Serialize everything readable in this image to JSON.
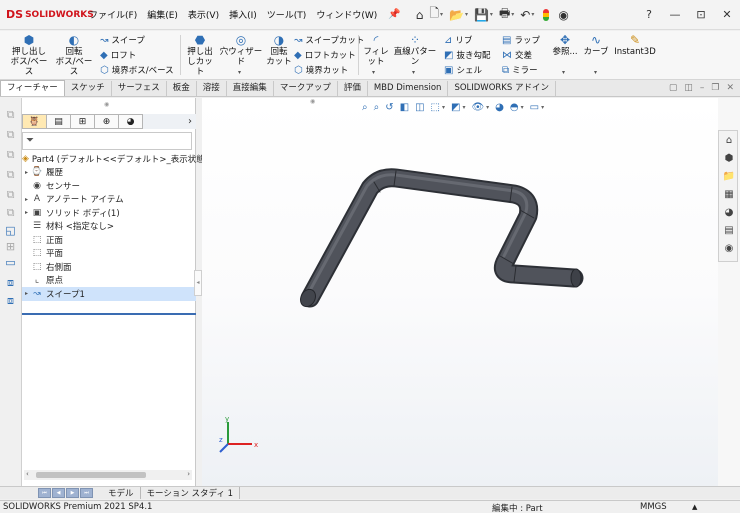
{
  "app": {
    "logo_mark": "DS",
    "logo_text": "SOLIDWORKS"
  },
  "menu": [
    "ファイル(F)",
    "編集(E)",
    "表示(V)",
    "挿入(I)",
    "ツール(T)",
    "ウィンドウ(W)"
  ],
  "quick_access": [
    "home-icon",
    "new-document-icon",
    "open-icon",
    "save-icon",
    "print-icon",
    "undo-icon",
    "rebuild-icon",
    "options-icon"
  ],
  "window_controls": {
    "help": "?",
    "minimize": "—",
    "restore": "⊡",
    "close": "✕"
  },
  "ribbon": {
    "extrude_boss": [
      "押し出し",
      "ボス/ベース"
    ],
    "revolve_boss": [
      "回転",
      "ボス/ベース"
    ],
    "sweep": "スイープ",
    "loft": "ロフト",
    "boundary_boss": "境界ボス/ベース",
    "extrude_cut": [
      "押し出",
      "しカット"
    ],
    "hole_wizard": "穴ウィザード",
    "revolve_cut": [
      "回転",
      "カット"
    ],
    "swept_cut": "スイープカット",
    "lofted_cut": "ロフトカット",
    "boundary_cut": "境界カット",
    "fillet": "フィレット",
    "linear_pattern": "直線パターン",
    "rib": "リブ",
    "draft": "抜き勾配",
    "shell": "シェル",
    "wrap": "ラップ",
    "intersect": "交差",
    "mirror": "ミラー",
    "reference": "参照...",
    "curves": "カーブ",
    "instant3d": "Instant3D"
  },
  "tabs": [
    "フィーチャー",
    "スケッチ",
    "サーフェス",
    "板金",
    "溶接",
    "直接編集",
    "マークアップ",
    "評価",
    "MBD Dimension",
    "SOLIDWORKS アドイン"
  ],
  "active_tab": "フィーチャー",
  "feature_tree": {
    "root": "Part4 (デフォルト<<デフォルト>_表示状態",
    "items": [
      {
        "label": "履歴",
        "icon": "history-icon",
        "expandable": true
      },
      {
        "label": "センサー",
        "icon": "sensor-icon",
        "expandable": false
      },
      {
        "label": "アノテート アイテム",
        "icon": "annotation-icon",
        "expandable": true
      },
      {
        "label": "ソリッド ボディ(1)",
        "icon": "solid-body-icon",
        "expandable": true
      },
      {
        "label": "材料 <指定なし>",
        "icon": "material-icon",
        "expandable": false
      },
      {
        "label": "正面",
        "icon": "plane-icon",
        "expandable": false
      },
      {
        "label": "平面",
        "icon": "plane-icon",
        "expandable": false
      },
      {
        "label": "右側面",
        "icon": "plane-icon",
        "expandable": false
      },
      {
        "label": "原点",
        "icon": "origin-icon",
        "expandable": false
      },
      {
        "label": "スイープ1",
        "icon": "sweep-icon",
        "expandable": true,
        "selected": true
      }
    ]
  },
  "bottom_tabs": [
    "モデル",
    "モーション スタディ 1"
  ],
  "triad": {
    "x": "x",
    "y": "y",
    "z": "z"
  },
  "status": {
    "product": "SOLIDWORKS Premium 2021 SP4.1",
    "editing": "編集中 : Part",
    "units": "MMGS",
    "units_arrow": "▲"
  },
  "colors": {
    "brand": "#d0131b",
    "accent": "#2f6fb5",
    "selection": "#cfe3fb",
    "pipe": "#4a4d54"
  }
}
